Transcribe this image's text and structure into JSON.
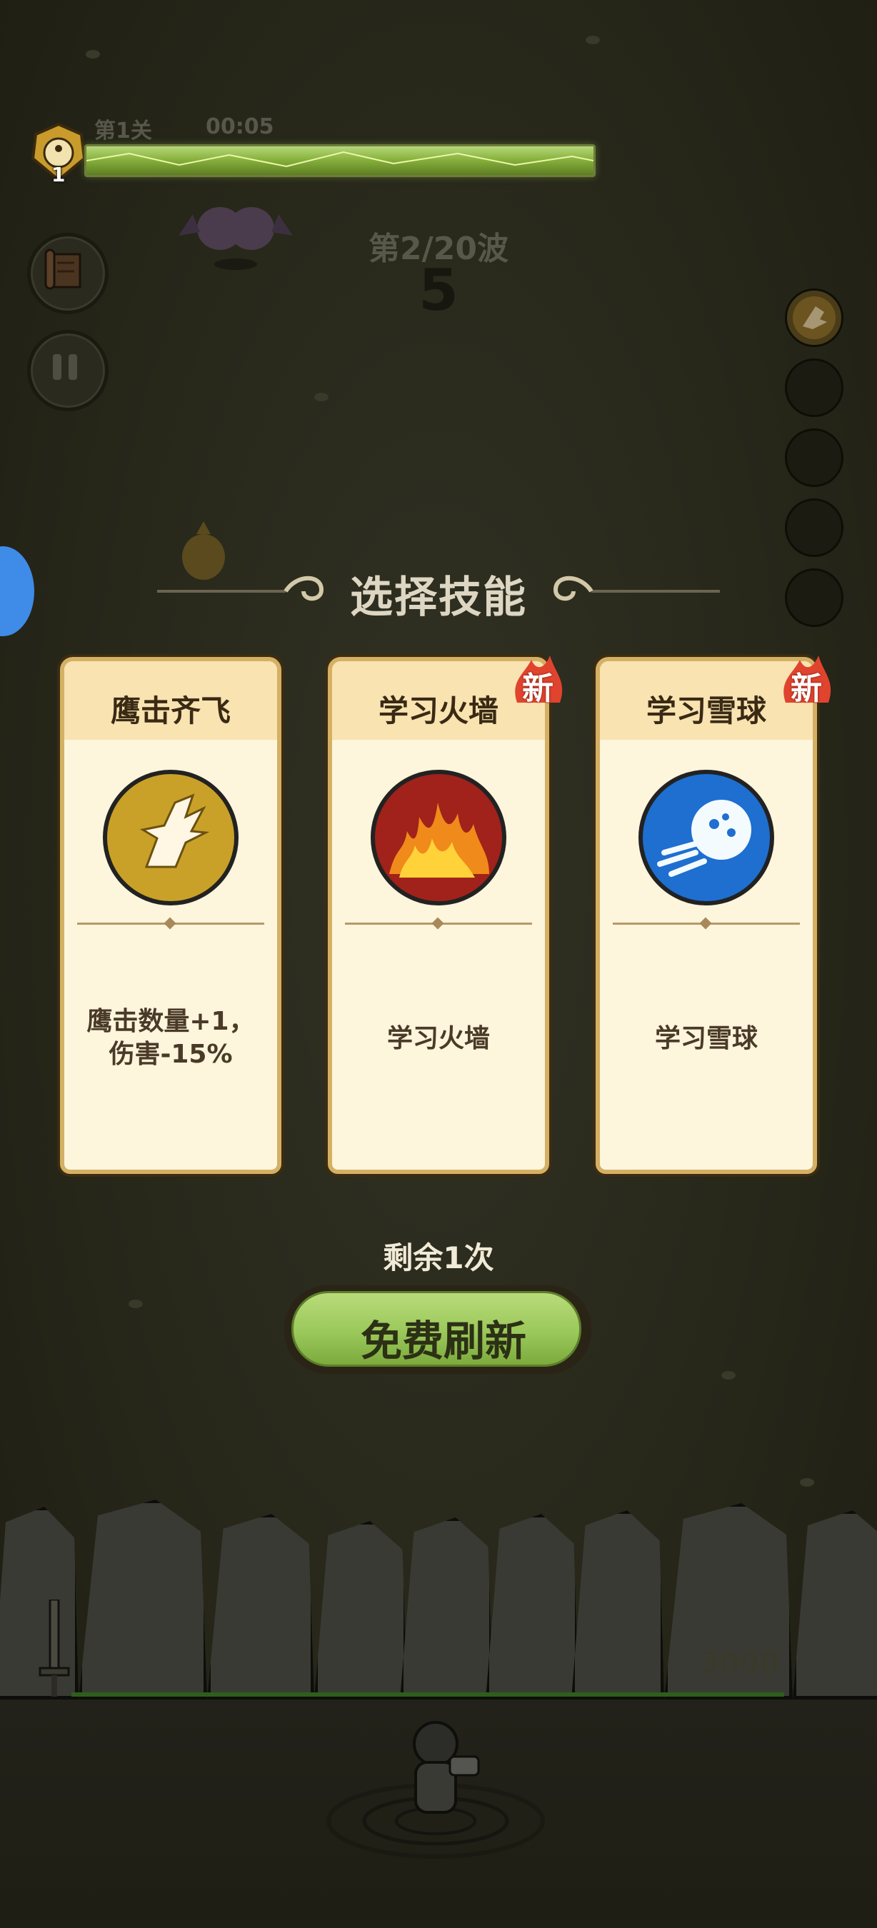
{
  "hud": {
    "level_number": "1",
    "level_label": "第1关",
    "timer": "00:05",
    "wave_label": "第2/20波",
    "countdown": "5"
  },
  "left_buttons": [
    {
      "icon": "scroll-icon"
    },
    {
      "icon": "pause-icon"
    }
  ],
  "skill_slots": [
    {
      "icon": "eagle-icon",
      "filled": true
    },
    {
      "filled": false
    },
    {
      "filled": false
    },
    {
      "filled": false
    },
    {
      "filled": false
    }
  ],
  "panel": {
    "title": "选择技能",
    "cards": [
      {
        "name": "鹰击齐飞",
        "desc": "鹰击数量+1，伤害-15%",
        "desc_line1": "鹰击数量+1，",
        "desc_line2": "伤害-15%",
        "icon": "eagle-icon",
        "is_new": false
      },
      {
        "name": "学习火墙",
        "desc": "学习火墙",
        "icon": "fire-icon",
        "is_new": true,
        "new_label": "新"
      },
      {
        "name": "学习雪球",
        "desc": "学习雪球",
        "icon": "snowball-icon",
        "is_new": true,
        "new_label": "新"
      }
    ],
    "remaining": "剩余1次",
    "refresh_label": "免费刷新"
  },
  "wall": {
    "hp": "3000"
  },
  "colors": {
    "background": "#262617",
    "card_border": "#d5b064",
    "card_bg": "#fdf5dc",
    "refresh_green": "#9ac85a",
    "energy_green": "#89b23e"
  }
}
